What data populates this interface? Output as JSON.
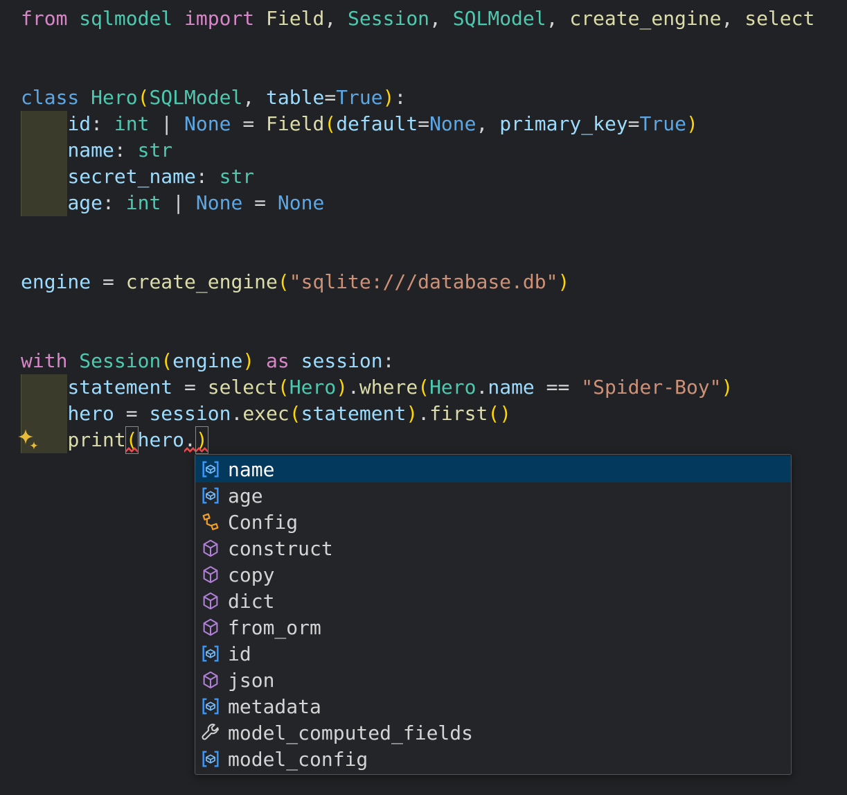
{
  "colors": {
    "editor_bg": "#212225",
    "keyword": "#D787C8",
    "keyword2": "#5CA7E4",
    "type": "#4EC9B0",
    "function": "#DCDCAA",
    "variable": "#9CDCFE",
    "punct": "#D4D4D4",
    "bracket": "#FFD700",
    "string": "#CE9178",
    "error": "#F14C4C",
    "indent_highlight": "#3A3B2B",
    "suggest_bg": "#242529",
    "suggest_border": "#55565A",
    "suggest_text": "#D4D4D4",
    "suggest_selected_bg": "#04395E",
    "suggest_selected_text": "#FFFFFF",
    "sparkle": "#E8BC3A",
    "icon_field_bracket": "#3B99FC",
    "icon_field_box": "#75BEFF",
    "icon_class": "#EE9D28",
    "icon_method": "#B180D7",
    "icon_property": "#CFCFCF"
  },
  "editor": {
    "lines": [
      [
        {
          "c": "kw",
          "t": "from"
        },
        {
          "c": "pl",
          "t": " "
        },
        {
          "c": "ty",
          "t": "sqlmodel"
        },
        {
          "c": "kw",
          "t": " import "
        },
        {
          "c": "fn",
          "t": "Field"
        },
        {
          "c": "pu",
          "t": ", "
        },
        {
          "c": "ty",
          "t": "Session"
        },
        {
          "c": "pu",
          "t": ", "
        },
        {
          "c": "ty",
          "t": "SQLModel"
        },
        {
          "c": "pu",
          "t": ", "
        },
        {
          "c": "fn",
          "t": "create_engine"
        },
        {
          "c": "pu",
          "t": ", "
        },
        {
          "c": "fn",
          "t": "select"
        }
      ],
      [],
      [],
      [
        {
          "c": "kb",
          "t": "class"
        },
        {
          "c": "pl",
          "t": " "
        },
        {
          "c": "ty",
          "t": "Hero"
        },
        {
          "c": "br",
          "t": "("
        },
        {
          "c": "ty",
          "t": "SQLModel"
        },
        {
          "c": "pu",
          "t": ", "
        },
        {
          "c": "va",
          "t": "table"
        },
        {
          "c": "pu",
          "t": "="
        },
        {
          "c": "kb",
          "t": "True"
        },
        {
          "c": "br",
          "t": ")"
        },
        {
          "c": "pu",
          "t": ":"
        }
      ],
      [
        {
          "c": "pl",
          "t": "    "
        },
        {
          "c": "va",
          "t": "id"
        },
        {
          "c": "pu",
          "t": ": "
        },
        {
          "c": "ty",
          "t": "int"
        },
        {
          "c": "pu",
          "t": " | "
        },
        {
          "c": "kb",
          "t": "None"
        },
        {
          "c": "pu",
          "t": " = "
        },
        {
          "c": "fn",
          "t": "Field"
        },
        {
          "c": "br",
          "t": "("
        },
        {
          "c": "va",
          "t": "default"
        },
        {
          "c": "pu",
          "t": "="
        },
        {
          "c": "kb",
          "t": "None"
        },
        {
          "c": "pu",
          "t": ", "
        },
        {
          "c": "va",
          "t": "primary_key"
        },
        {
          "c": "pu",
          "t": "="
        },
        {
          "c": "kb",
          "t": "True"
        },
        {
          "c": "br",
          "t": ")"
        }
      ],
      [
        {
          "c": "pl",
          "t": "    "
        },
        {
          "c": "va",
          "t": "name"
        },
        {
          "c": "pu",
          "t": ": "
        },
        {
          "c": "ty",
          "t": "str"
        }
      ],
      [
        {
          "c": "pl",
          "t": "    "
        },
        {
          "c": "va",
          "t": "secret_name"
        },
        {
          "c": "pu",
          "t": ": "
        },
        {
          "c": "ty",
          "t": "str"
        }
      ],
      [
        {
          "c": "pl",
          "t": "    "
        },
        {
          "c": "va",
          "t": "age"
        },
        {
          "c": "pu",
          "t": ": "
        },
        {
          "c": "ty",
          "t": "int"
        },
        {
          "c": "pu",
          "t": " | "
        },
        {
          "c": "kb",
          "t": "None"
        },
        {
          "c": "pu",
          "t": " = "
        },
        {
          "c": "kb",
          "t": "None"
        }
      ],
      [],
      [],
      [
        {
          "c": "va",
          "t": "engine"
        },
        {
          "c": "pu",
          "t": " = "
        },
        {
          "c": "fn",
          "t": "create_engine"
        },
        {
          "c": "br",
          "t": "("
        },
        {
          "c": "st",
          "t": "\"sqlite:///database.db\""
        },
        {
          "c": "br",
          "t": ")"
        }
      ],
      [],
      [],
      [
        {
          "c": "kw",
          "t": "with"
        },
        {
          "c": "pl",
          "t": " "
        },
        {
          "c": "ty",
          "t": "Session"
        },
        {
          "c": "br",
          "t": "("
        },
        {
          "c": "va",
          "t": "engine"
        },
        {
          "c": "br",
          "t": ")"
        },
        {
          "c": "pl",
          "t": " "
        },
        {
          "c": "kw",
          "t": "as"
        },
        {
          "c": "pl",
          "t": " "
        },
        {
          "c": "va",
          "t": "session"
        },
        {
          "c": "pu",
          "t": ":"
        }
      ],
      [
        {
          "c": "pl",
          "t": "    "
        },
        {
          "c": "va",
          "t": "statement"
        },
        {
          "c": "pu",
          "t": " = "
        },
        {
          "c": "fn",
          "t": "select"
        },
        {
          "c": "br",
          "t": "("
        },
        {
          "c": "ty",
          "t": "Hero"
        },
        {
          "c": "br",
          "t": ")"
        },
        {
          "c": "pu",
          "t": "."
        },
        {
          "c": "fn",
          "t": "where"
        },
        {
          "c": "br",
          "t": "("
        },
        {
          "c": "ty",
          "t": "Hero"
        },
        {
          "c": "pu",
          "t": "."
        },
        {
          "c": "va",
          "t": "name"
        },
        {
          "c": "pu",
          "t": " == "
        },
        {
          "c": "st",
          "t": "\"Spider-Boy\""
        },
        {
          "c": "br",
          "t": ")"
        }
      ],
      [
        {
          "c": "pl",
          "t": "    "
        },
        {
          "c": "va",
          "t": "hero"
        },
        {
          "c": "pu",
          "t": " = "
        },
        {
          "c": "va",
          "t": "session"
        },
        {
          "c": "pu",
          "t": "."
        },
        {
          "c": "fn",
          "t": "exec"
        },
        {
          "c": "br",
          "t": "("
        },
        {
          "c": "va",
          "t": "statement"
        },
        {
          "c": "br",
          "t": ")"
        },
        {
          "c": "pu",
          "t": "."
        },
        {
          "c": "fn",
          "t": "first"
        },
        {
          "c": "br",
          "t": "()"
        }
      ],
      [
        {
          "c": "pl",
          "t": "    "
        },
        {
          "c": "fn",
          "t": "print"
        },
        {
          "c": "br",
          "t": "(",
          "box": true,
          "sq": true
        },
        {
          "c": "va",
          "t": "hero"
        },
        {
          "c": "pu",
          "t": ".",
          "sq": true
        },
        {
          "c": "br",
          "t": ")",
          "box": true,
          "sq": true
        }
      ]
    ]
  },
  "suggest": {
    "items": [
      {
        "kind": "field",
        "label": "name",
        "selected": true
      },
      {
        "kind": "field",
        "label": "age"
      },
      {
        "kind": "class",
        "label": "Config"
      },
      {
        "kind": "method",
        "label": "construct"
      },
      {
        "kind": "method",
        "label": "copy"
      },
      {
        "kind": "method",
        "label": "dict"
      },
      {
        "kind": "method",
        "label": "from_orm"
      },
      {
        "kind": "field",
        "label": "id"
      },
      {
        "kind": "method",
        "label": "json"
      },
      {
        "kind": "field",
        "label": "metadata"
      },
      {
        "kind": "property",
        "label": "model_computed_fields"
      },
      {
        "kind": "field",
        "label": "model_config"
      }
    ]
  }
}
